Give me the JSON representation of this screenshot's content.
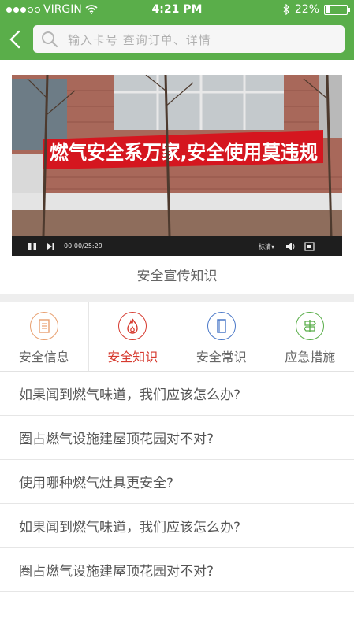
{
  "status_bar": {
    "carrier": "VIRGIN",
    "time": "4:21 PM",
    "battery_percent": "22%",
    "battery_level": 0.22
  },
  "search": {
    "placeholder": "输入卡号 查询订单、详情"
  },
  "video": {
    "banner_text": "燃气安全系万家,安全使用莫违规",
    "time": "00:00/25:29",
    "quality": "标清▾",
    "caption": "安全宣传知识"
  },
  "categories": [
    {
      "label": "安全信息",
      "icon": "document-icon",
      "color": "#e8a070"
    },
    {
      "label": "安全知识",
      "icon": "flame-icon",
      "color": "#d63a2f"
    },
    {
      "label": "安全常识",
      "icon": "book-icon",
      "color": "#4a78c8"
    },
    {
      "label": "应急措施",
      "icon": "signpost-icon",
      "color": "#5aae4a"
    }
  ],
  "questions": [
    "如果闻到燃气味道，我们应该怎么办?",
    "圈占燃气设施建屋顶花园对不对?",
    "使用哪种燃气灶具更安全?",
    "如果闻到燃气味道，我们应该怎么办?",
    "圈占燃气设施建屋顶花园对不对?"
  ],
  "colors": {
    "brand_green": "#5aae4a",
    "active_red": "#d63a2f"
  }
}
